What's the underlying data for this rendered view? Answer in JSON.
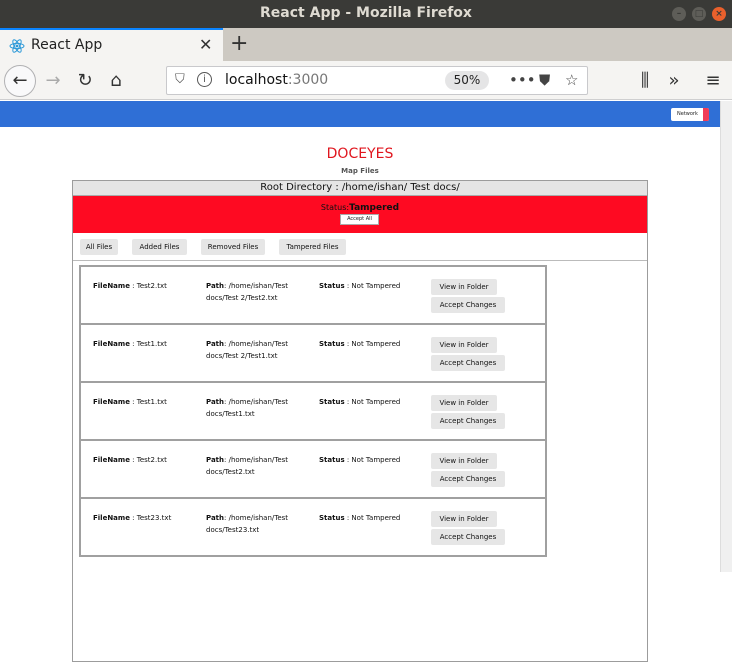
{
  "window": {
    "title": "React App - Mozilla Firefox"
  },
  "tab": {
    "title": "React App",
    "favicon": "react-icon"
  },
  "urlbar": {
    "host": "localhost",
    "port": ":3000",
    "zoom": "50%"
  },
  "app": {
    "network_label": "Network",
    "brand": "DOCEYES",
    "subtitle": "Map Files",
    "root_directory": "Root Directory : /home/ishan/ Test docs/",
    "status_label": "Status:",
    "status_value": "Tampered",
    "accept_all": "Accept All",
    "filters": [
      "All Files",
      "Added Files",
      "Removed Files",
      "Tampered Files"
    ],
    "colors": {
      "appbar": "#2f6fd6",
      "statusbar": "#fe0a22",
      "brand": "#e0161e"
    }
  },
  "labels": {
    "filename": "FileName",
    "path": "Path",
    "status": "Status",
    "view_in_folder": "View in Folder",
    "accept_changes": "Accept Changes"
  },
  "files": [
    {
      "name": "Test2.txt",
      "path1": ": /home/ishan/Test",
      "path2": "docs/Test 2/Test2.txt",
      "status": "Not Tampered"
    },
    {
      "name": "Test1.txt",
      "path1": ": /home/ishan/Test",
      "path2": "docs/Test 2/Test1.txt",
      "status": "Not Tampered"
    },
    {
      "name": "Test1.txt",
      "path1": ": /home/ishan/Test",
      "path2": "docs/Test1.txt",
      "status": "Not Tampered"
    },
    {
      "name": "Test2.txt",
      "path1": ": /home/ishan/Test",
      "path2": "docs/Test2.txt",
      "status": "Not Tampered"
    },
    {
      "name": "Test23.txt",
      "path1": ": /home/ishan/Test",
      "path2": "docs/Test23.txt",
      "status": "Not Tampered"
    }
  ]
}
